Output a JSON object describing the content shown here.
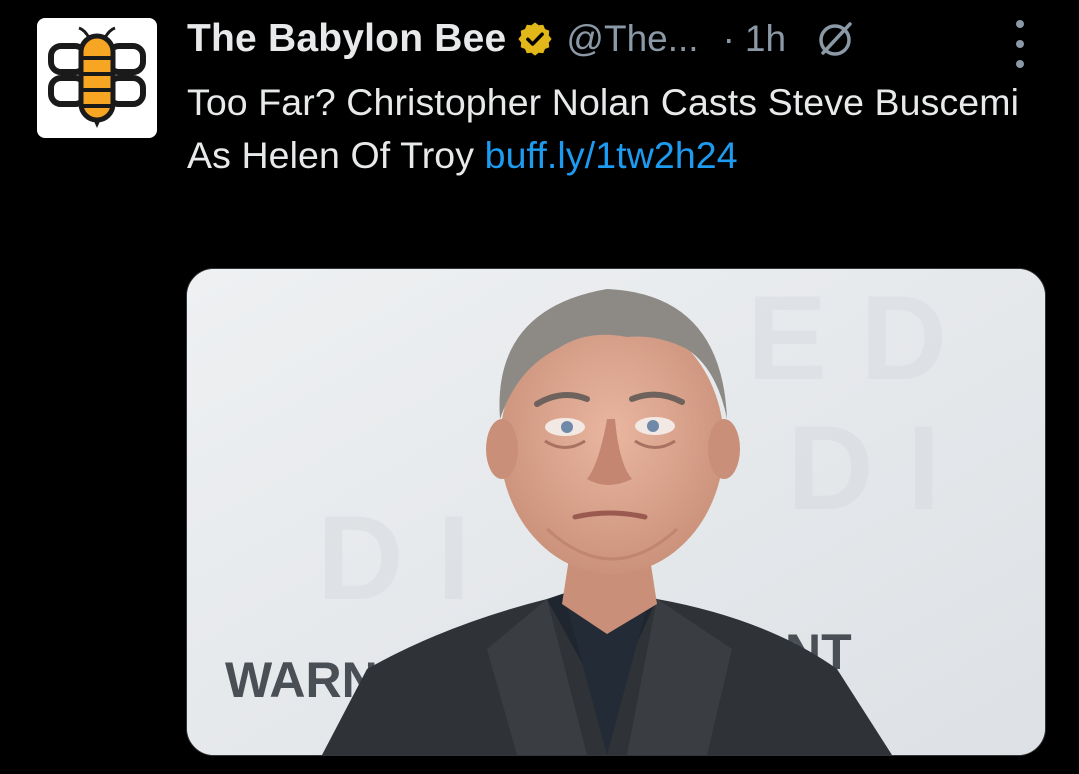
{
  "tweet": {
    "author": {
      "display_name": "The Babylon Bee",
      "handle": "@The...",
      "verified": true,
      "avatar_icon": "babylon-bee-logo"
    },
    "separator": "·",
    "time": "1h",
    "text_main": "Too Far? Christopher Nolan Casts Steve Buscemi As Helen Of Troy ",
    "link": "buff.ly/1tw2h24",
    "media": {
      "backdrop_text": "WARNE",
      "backdrop_text_right": "NT"
    }
  },
  "icons": {
    "verified": "verified-badge-icon",
    "grok": "grok-icon",
    "more": "more-options-icon"
  },
  "colors": {
    "background": "#000000",
    "text": "#e7e9ea",
    "secondary": "#8b98a5",
    "link": "#1d9bf0",
    "verified_gold": "#e2b719",
    "bee_orange": "#f6a623"
  }
}
